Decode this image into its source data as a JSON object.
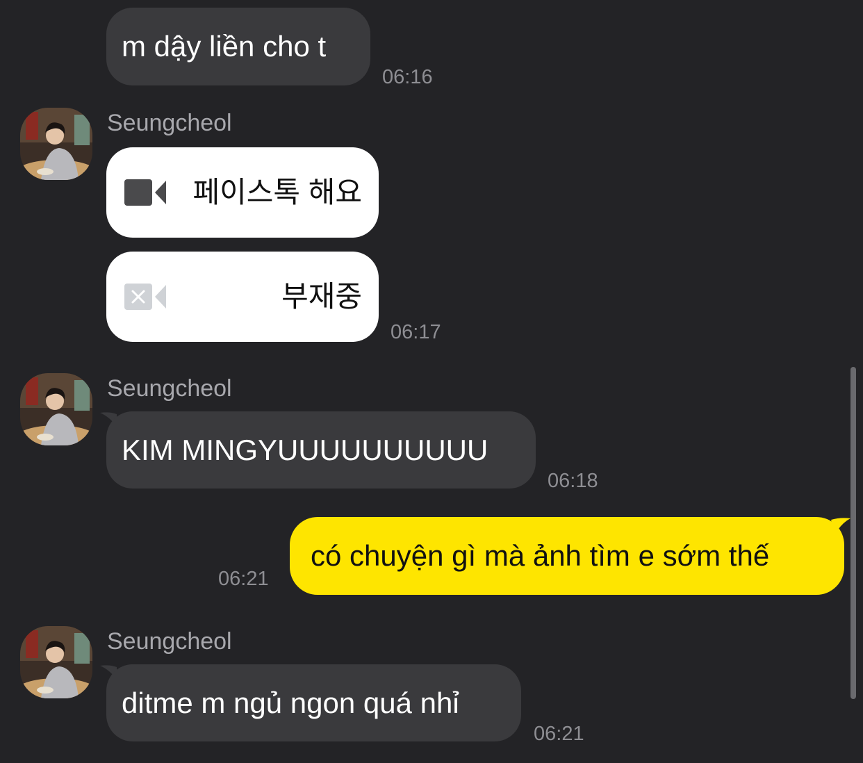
{
  "colors": {
    "background": "#232326",
    "incoming_bubble": "#3a3a3d",
    "outgoing_bubble": "#fee500",
    "call_bubble": "#ffffff",
    "timestamp": "#8e8e93"
  },
  "messages": {
    "m1": {
      "text": "m dậy liền cho t",
      "time": "06:16"
    },
    "g1": {
      "sender": "Seungcheol",
      "call1": {
        "icon": "video-call-icon",
        "text": "페이스톡 해요"
      },
      "call2": {
        "icon": "missed-video-call-icon",
        "text": "부재중",
        "time": "06:17"
      }
    },
    "g2": {
      "sender": "Seungcheol",
      "text": "KIM MINGYUUUUUUUUUU",
      "time": "06:18"
    },
    "me1": {
      "text": "có chuyện gì mà ảnh tìm e sớm thế",
      "time": "06:21"
    },
    "g3": {
      "sender": "Seungcheol",
      "text": "ditme m ngủ ngon quá nhỉ",
      "time": "06:21"
    }
  }
}
